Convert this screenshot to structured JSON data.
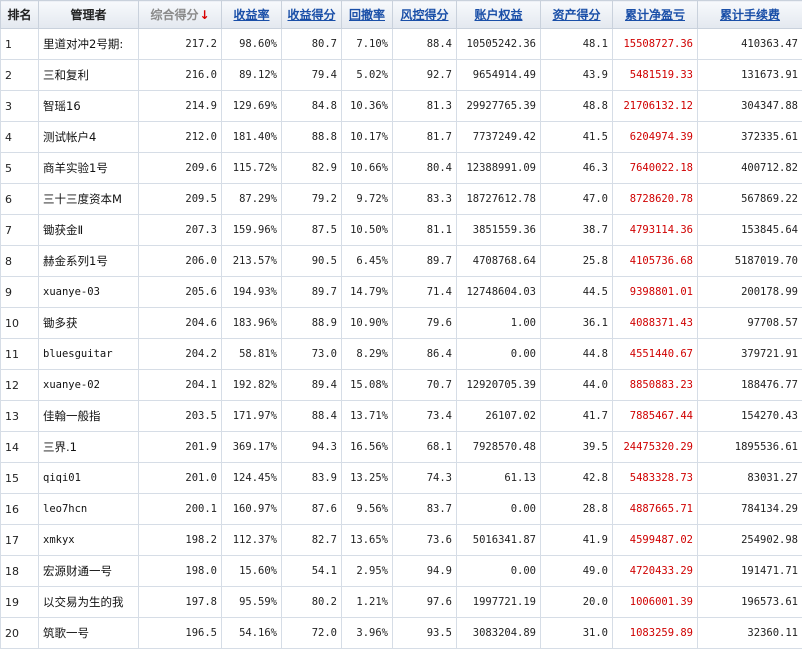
{
  "headers": {
    "rank": "排名",
    "manager": "管理者",
    "composite_score": "综合得分",
    "sort_arrow": "↓",
    "return_rate": "收益率",
    "return_score": "收益得分",
    "drawdown": "回撤率",
    "risk_score": "风控得分",
    "account_equity": "账户权益",
    "asset_score": "资产得分",
    "cumulative_net_profit": "累计净盈亏",
    "cumulative_fees": "累计手续费"
  },
  "colors": {
    "profit": "#d00000",
    "link": "#1a4fa8",
    "sort_arrow": "#d80000"
  },
  "rows": [
    {
      "rank": "1",
      "manager": "里道对冲2号期:",
      "score": "217.2",
      "ret": "98.60%",
      "ret_score": "80.7",
      "dd": "7.10%",
      "risk": "88.4",
      "equity": "10505242.36",
      "asset": "48.1",
      "profit": "15508727.36",
      "fees": "410363.47"
    },
    {
      "rank": "2",
      "manager": "三和复利",
      "score": "216.0",
      "ret": "89.12%",
      "ret_score": "79.4",
      "dd": "5.02%",
      "risk": "92.7",
      "equity": "9654914.49",
      "asset": "43.9",
      "profit": "5481519.33",
      "fees": "131673.91"
    },
    {
      "rank": "3",
      "manager": "智瑶16",
      "score": "214.9",
      "ret": "129.69%",
      "ret_score": "84.8",
      "dd": "10.36%",
      "risk": "81.3",
      "equity": "29927765.39",
      "asset": "48.8",
      "profit": "21706132.12",
      "fees": "304347.88"
    },
    {
      "rank": "4",
      "manager": "测试帐户4",
      "score": "212.0",
      "ret": "181.40%",
      "ret_score": "88.8",
      "dd": "10.17%",
      "risk": "81.7",
      "equity": "7737249.42",
      "asset": "41.5",
      "profit": "6204974.39",
      "fees": "372335.61"
    },
    {
      "rank": "5",
      "manager": "商羊实验1号",
      "score": "209.6",
      "ret": "115.72%",
      "ret_score": "82.9",
      "dd": "10.66%",
      "risk": "80.4",
      "equity": "12388991.09",
      "asset": "46.3",
      "profit": "7640022.18",
      "fees": "400712.82"
    },
    {
      "rank": "6",
      "manager": "三十三度资本M",
      "score": "209.5",
      "ret": "87.29%",
      "ret_score": "79.2",
      "dd": "9.72%",
      "risk": "83.3",
      "equity": "18727612.78",
      "asset": "47.0",
      "profit": "8728620.78",
      "fees": "567869.22"
    },
    {
      "rank": "7",
      "manager": "锄获金Ⅱ",
      "score": "207.3",
      "ret": "159.96%",
      "ret_score": "87.5",
      "dd": "10.50%",
      "risk": "81.1",
      "equity": "3851559.36",
      "asset": "38.7",
      "profit": "4793114.36",
      "fees": "153845.64"
    },
    {
      "rank": "8",
      "manager": "赫金系列1号",
      "score": "206.0",
      "ret": "213.57%",
      "ret_score": "90.5",
      "dd": "6.45%",
      "risk": "89.7",
      "equity": "4708768.64",
      "asset": "25.8",
      "profit": "4105736.68",
      "fees": "5187019.70"
    },
    {
      "rank": "9",
      "manager": "xuanye-03",
      "score": "205.6",
      "ret": "194.93%",
      "ret_score": "89.7",
      "dd": "14.79%",
      "risk": "71.4",
      "equity": "12748604.03",
      "asset": "44.5",
      "profit": "9398801.01",
      "fees": "200178.99"
    },
    {
      "rank": "10",
      "manager": "锄多获",
      "score": "204.6",
      "ret": "183.96%",
      "ret_score": "88.9",
      "dd": "10.90%",
      "risk": "79.6",
      "equity": "1.00",
      "asset": "36.1",
      "profit": "4088371.43",
      "fees": "97708.57"
    },
    {
      "rank": "11",
      "manager": "bluesguitar",
      "score": "204.2",
      "ret": "58.81%",
      "ret_score": "73.0",
      "dd": "8.29%",
      "risk": "86.4",
      "equity": "0.00",
      "asset": "44.8",
      "profit": "4551440.67",
      "fees": "379721.91"
    },
    {
      "rank": "12",
      "manager": "xuanye-02",
      "score": "204.1",
      "ret": "192.82%",
      "ret_score": "89.4",
      "dd": "15.08%",
      "risk": "70.7",
      "equity": "12920705.39",
      "asset": "44.0",
      "profit": "8850883.23",
      "fees": "188476.77"
    },
    {
      "rank": "13",
      "manager": "佳翰一般指",
      "score": "203.5",
      "ret": "171.97%",
      "ret_score": "88.4",
      "dd": "13.71%",
      "risk": "73.4",
      "equity": "26107.02",
      "asset": "41.7",
      "profit": "7885467.44",
      "fees": "154270.43"
    },
    {
      "rank": "14",
      "manager": "三界.1",
      "score": "201.9",
      "ret": "369.17%",
      "ret_score": "94.3",
      "dd": "16.56%",
      "risk": "68.1",
      "equity": "7928570.48",
      "asset": "39.5",
      "profit": "24475320.29",
      "fees": "1895536.61"
    },
    {
      "rank": "15",
      "manager": "qiqi01",
      "score": "201.0",
      "ret": "124.45%",
      "ret_score": "83.9",
      "dd": "13.25%",
      "risk": "74.3",
      "equity": "61.13",
      "asset": "42.8",
      "profit": "5483328.73",
      "fees": "83031.27"
    },
    {
      "rank": "16",
      "manager": "leo7hcn",
      "score": "200.1",
      "ret": "160.97%",
      "ret_score": "87.6",
      "dd": "9.56%",
      "risk": "83.7",
      "equity": "0.00",
      "asset": "28.8",
      "profit": "4887665.71",
      "fees": "784134.29"
    },
    {
      "rank": "17",
      "manager": "xmkyx",
      "score": "198.2",
      "ret": "112.37%",
      "ret_score": "82.7",
      "dd": "13.65%",
      "risk": "73.6",
      "equity": "5016341.87",
      "asset": "41.9",
      "profit": "4599487.02",
      "fees": "254902.98"
    },
    {
      "rank": "18",
      "manager": "宏源财通一号",
      "score": "198.0",
      "ret": "15.60%",
      "ret_score": "54.1",
      "dd": "2.95%",
      "risk": "94.9",
      "equity": "0.00",
      "asset": "49.0",
      "profit": "4720433.29",
      "fees": "191471.71"
    },
    {
      "rank": "19",
      "manager": "以交易为生的我",
      "score": "197.8",
      "ret": "95.59%",
      "ret_score": "80.2",
      "dd": "1.21%",
      "risk": "97.6",
      "equity": "1997721.19",
      "asset": "20.0",
      "profit": "1006001.39",
      "fees": "196573.61"
    },
    {
      "rank": "20",
      "manager": "筑歌一号",
      "score": "196.5",
      "ret": "54.16%",
      "ret_score": "72.0",
      "dd": "3.96%",
      "risk": "93.5",
      "equity": "3083204.89",
      "asset": "31.0",
      "profit": "1083259.89",
      "fees": "32360.11"
    }
  ]
}
